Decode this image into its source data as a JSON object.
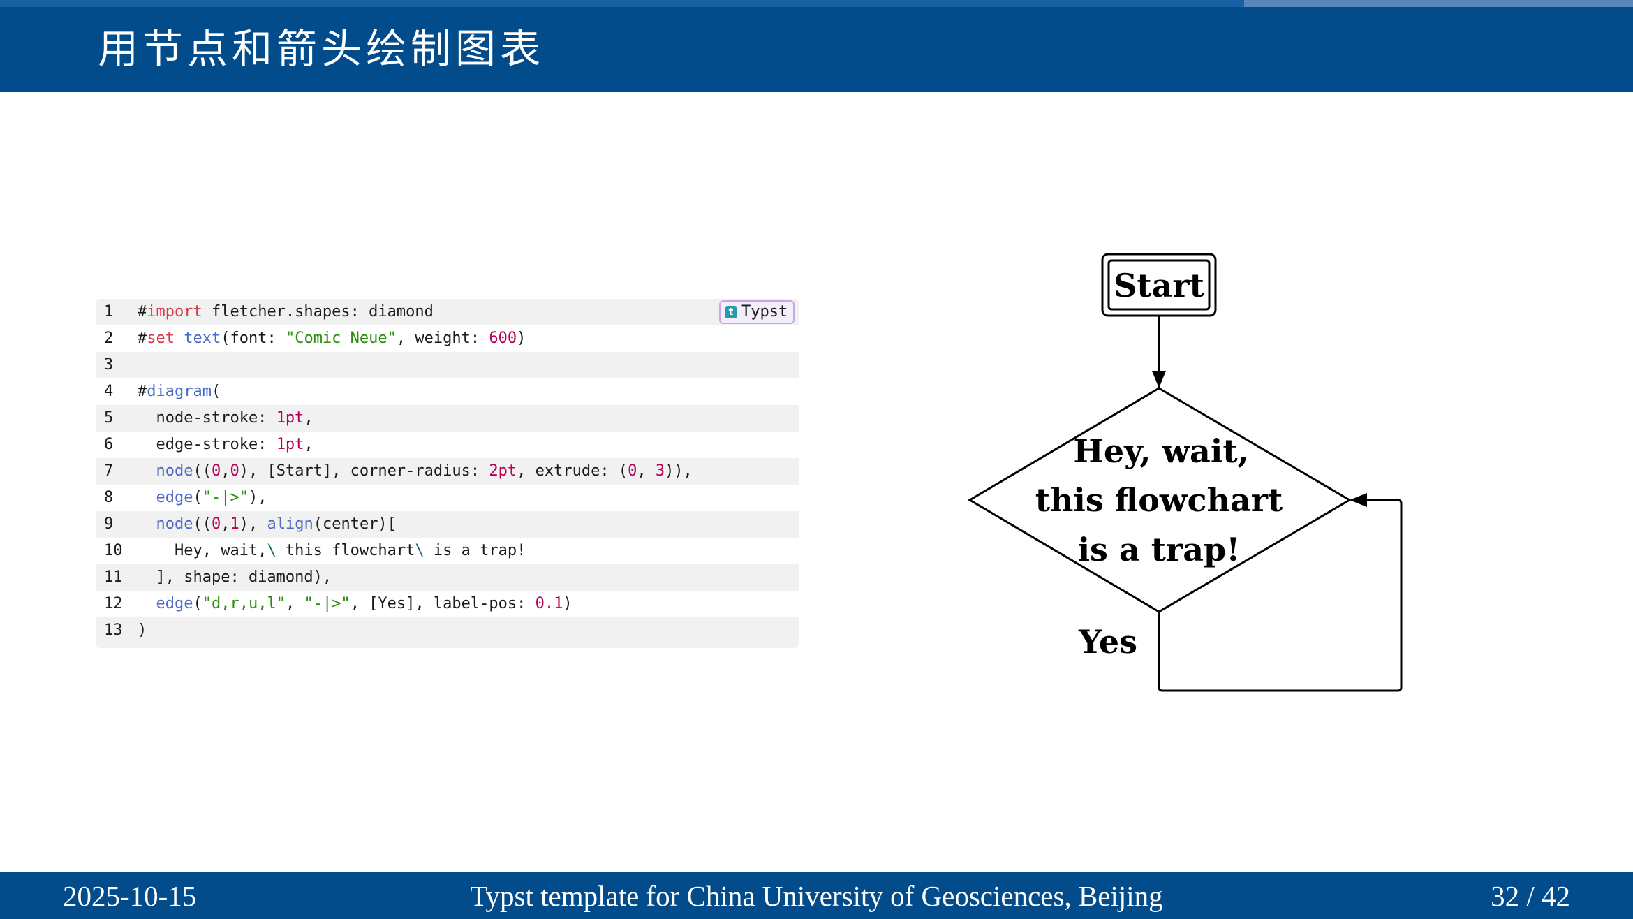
{
  "header": {
    "title": "用节点和箭头绘制图表"
  },
  "progress": {
    "current": 32,
    "total": 42,
    "fraction": 0.762
  },
  "code_block": {
    "language": "Typst",
    "lines": [
      {
        "number": "1",
        "tokens": [
          {
            "t": "#",
            "c": ""
          },
          {
            "t": "import",
            "c": "kw"
          },
          {
            "t": " fletcher.shapes: diamond",
            "c": ""
          }
        ]
      },
      {
        "number": "2",
        "tokens": [
          {
            "t": "#",
            "c": ""
          },
          {
            "t": "set",
            "c": "kw"
          },
          {
            "t": " ",
            "c": ""
          },
          {
            "t": "text",
            "c": "fn"
          },
          {
            "t": "(font: ",
            "c": ""
          },
          {
            "t": "\"Comic Neue\"",
            "c": "str"
          },
          {
            "t": ", weight: ",
            "c": ""
          },
          {
            "t": "600",
            "c": "num"
          },
          {
            "t": ")",
            "c": ""
          }
        ]
      },
      {
        "number": "3",
        "tokens": []
      },
      {
        "number": "4",
        "tokens": [
          {
            "t": "#",
            "c": ""
          },
          {
            "t": "diagram",
            "c": "fn"
          },
          {
            "t": "(",
            "c": ""
          }
        ]
      },
      {
        "number": "5",
        "tokens": [
          {
            "t": "  node-stroke: ",
            "c": ""
          },
          {
            "t": "1pt",
            "c": "num"
          },
          {
            "t": ",",
            "c": ""
          }
        ]
      },
      {
        "number": "6",
        "tokens": [
          {
            "t": "  edge-stroke: ",
            "c": ""
          },
          {
            "t": "1pt",
            "c": "num"
          },
          {
            "t": ",",
            "c": ""
          }
        ]
      },
      {
        "number": "7",
        "tokens": [
          {
            "t": "  ",
            "c": ""
          },
          {
            "t": "node",
            "c": "fn"
          },
          {
            "t": "((",
            "c": ""
          },
          {
            "t": "0",
            "c": "num"
          },
          {
            "t": ",",
            "c": ""
          },
          {
            "t": "0",
            "c": "num"
          },
          {
            "t": "), [Start], corner-radius: ",
            "c": ""
          },
          {
            "t": "2pt",
            "c": "num"
          },
          {
            "t": ", extrude: (",
            "c": ""
          },
          {
            "t": "0",
            "c": "num"
          },
          {
            "t": ", ",
            "c": ""
          },
          {
            "t": "3",
            "c": "num"
          },
          {
            "t": ")),",
            "c": ""
          }
        ]
      },
      {
        "number": "8",
        "tokens": [
          {
            "t": "  ",
            "c": ""
          },
          {
            "t": "edge",
            "c": "fn"
          },
          {
            "t": "(",
            "c": ""
          },
          {
            "t": "\"-|>\"",
            "c": "str"
          },
          {
            "t": "),",
            "c": ""
          }
        ]
      },
      {
        "number": "9",
        "tokens": [
          {
            "t": "  ",
            "c": ""
          },
          {
            "t": "node",
            "c": "fn"
          },
          {
            "t": "((",
            "c": ""
          },
          {
            "t": "0",
            "c": "num"
          },
          {
            "t": ",",
            "c": ""
          },
          {
            "t": "1",
            "c": "num"
          },
          {
            "t": "), ",
            "c": ""
          },
          {
            "t": "align",
            "c": "fn"
          },
          {
            "t": "(center)[",
            "c": ""
          }
        ]
      },
      {
        "number": "10",
        "tokens": [
          {
            "t": "    Hey, wait,",
            "c": ""
          },
          {
            "t": "\\",
            "c": "esc"
          },
          {
            "t": " this flowchart",
            "c": ""
          },
          {
            "t": "\\",
            "c": "esc"
          },
          {
            "t": " is a trap!",
            "c": ""
          }
        ]
      },
      {
        "number": "11",
        "tokens": [
          {
            "t": "  ], shape: diamond),",
            "c": ""
          }
        ]
      },
      {
        "number": "12",
        "tokens": [
          {
            "t": "  ",
            "c": ""
          },
          {
            "t": "edge",
            "c": "fn"
          },
          {
            "t": "(",
            "c": ""
          },
          {
            "t": "\"d,r,u,l\"",
            "c": "str"
          },
          {
            "t": ", ",
            "c": ""
          },
          {
            "t": "\"-|>\"",
            "c": "str"
          },
          {
            "t": ", [Yes], label-pos: ",
            "c": ""
          },
          {
            "t": "0.1",
            "c": "num"
          },
          {
            "t": ")",
            "c": ""
          }
        ]
      },
      {
        "number": "13",
        "tokens": [
          {
            "t": ")",
            "c": ""
          }
        ]
      }
    ]
  },
  "flowchart": {
    "start_label": "Start",
    "decision_lines": [
      "Hey, wait,",
      "this flowchart",
      "is a trap!"
    ],
    "edge_label": "Yes"
  },
  "footer": {
    "date": "2025-10-15",
    "center": "Typst template for China University of Geosciences, Beijing",
    "page": "32 / 42"
  },
  "colors": {
    "primary": "#024c8c",
    "progress_track": "#5b86b9",
    "progress_fill": "#1b5fa3",
    "keyword": "#d73a49",
    "function": "#4b69c6",
    "string": "#298e0d",
    "number": "#b60157"
  },
  "icons": {
    "lang_badge": "typst-logo-icon"
  }
}
